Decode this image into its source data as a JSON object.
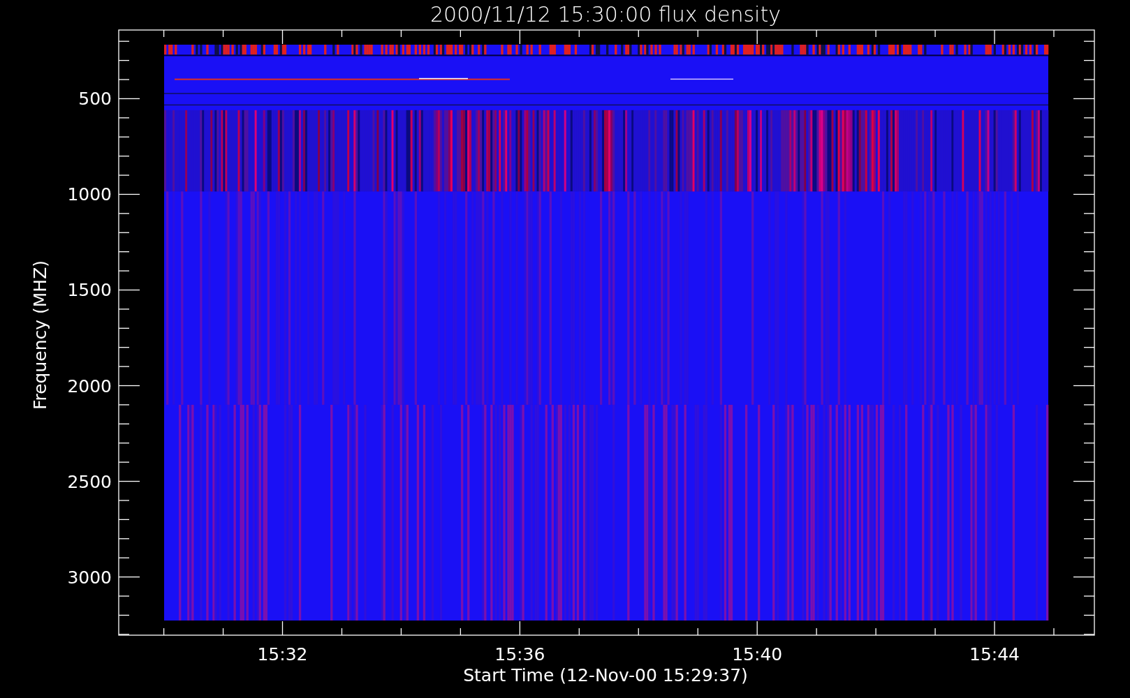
{
  "plot": {
    "title": "2000/11/12 15:30:00 flux density",
    "xlabel": "Start Time (12-Nov-00 15:29:37)",
    "ylabel": "Frequency (MHZ)",
    "x_tick_labels": [
      "15:32",
      "15:36",
      "15:40",
      "15:44"
    ],
    "y_tick_labels": [
      "500",
      "1000",
      "1500",
      "2000",
      "2500",
      "3000"
    ]
  }
}
